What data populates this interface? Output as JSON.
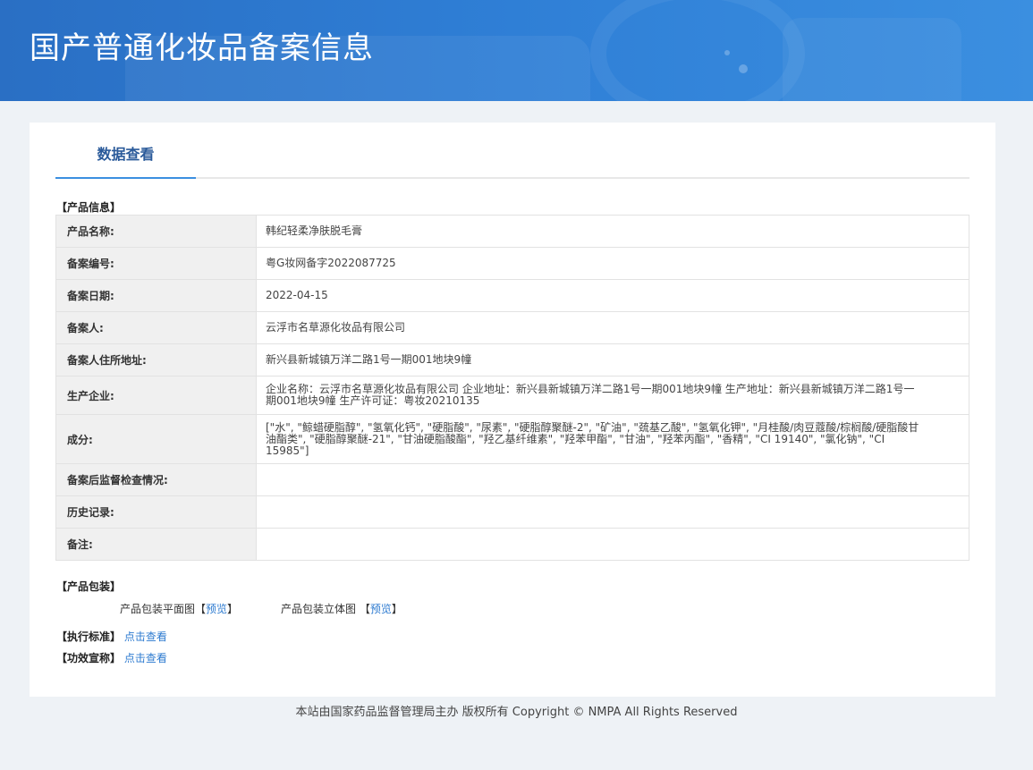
{
  "header": {
    "title": "国产普通化妆品备案信息"
  },
  "tabs": {
    "active": "数据查看"
  },
  "product_info": {
    "section_title": "【产品信息】",
    "rows": [
      {
        "label": "产品名称:",
        "value": "韩纪轻柔净肤脱毛膏"
      },
      {
        "label": "备案编号:",
        "value": "粤G妆网备字2022087725"
      },
      {
        "label": "备案日期:",
        "value": "2022-04-15"
      },
      {
        "label": "备案人:",
        "value": "云浮市名草源化妆品有限公司"
      },
      {
        "label": "备案人住所地址:",
        "value": "新兴县新城镇万洋二路1号一期001地块9幢"
      },
      {
        "label": "生产企业:",
        "value": "企业名称：云浮市名草源化妆品有限公司 企业地址：新兴县新城镇万洋二路1号一期001地块9幢 生产地址：新兴县新城镇万洋二路1号一期001地块9幢 生产许可证：粤妆20210135"
      },
      {
        "label": "成分:",
        "value": "[\"水\", \"鲸蜡硬脂醇\", \"氢氧化钙\", \"硬脂酸\", \"尿素\", \"硬脂醇聚醚-2\", \"矿油\", \"巯基乙酸\", \"氢氧化钾\", \"月桂酸/肉豆蔻酸/棕榈酸/硬脂酸甘油酯类\", \"硬脂醇聚醚-21\", \"甘油硬脂酸酯\", \"羟乙基纤维素\", \"羟苯甲酯\", \"甘油\", \"羟苯丙酯\", \"香精\", \"CI 19140\", \"氯化钠\", \"CI 15985\"]"
      },
      {
        "label": "备案后监督检查情况:",
        "value": ""
      },
      {
        "label": "历史记录:",
        "value": ""
      },
      {
        "label": "备注:",
        "value": ""
      }
    ]
  },
  "packaging": {
    "section_title": "【产品包装】",
    "flat_label": "产品包装平面图",
    "solid_label": "产品包装立体图",
    "bracket_open": "【",
    "bracket_close": "】",
    "preview_label": "预览"
  },
  "standard": {
    "label": "【执行标准】",
    "link": "点击查看"
  },
  "claims": {
    "label": "【功效宣称】",
    "link": "点击查看"
  },
  "footer": {
    "text": "本站由国家药品监督管理局主办 版权所有 Copyright © NMPA All Rights Reserved"
  }
}
